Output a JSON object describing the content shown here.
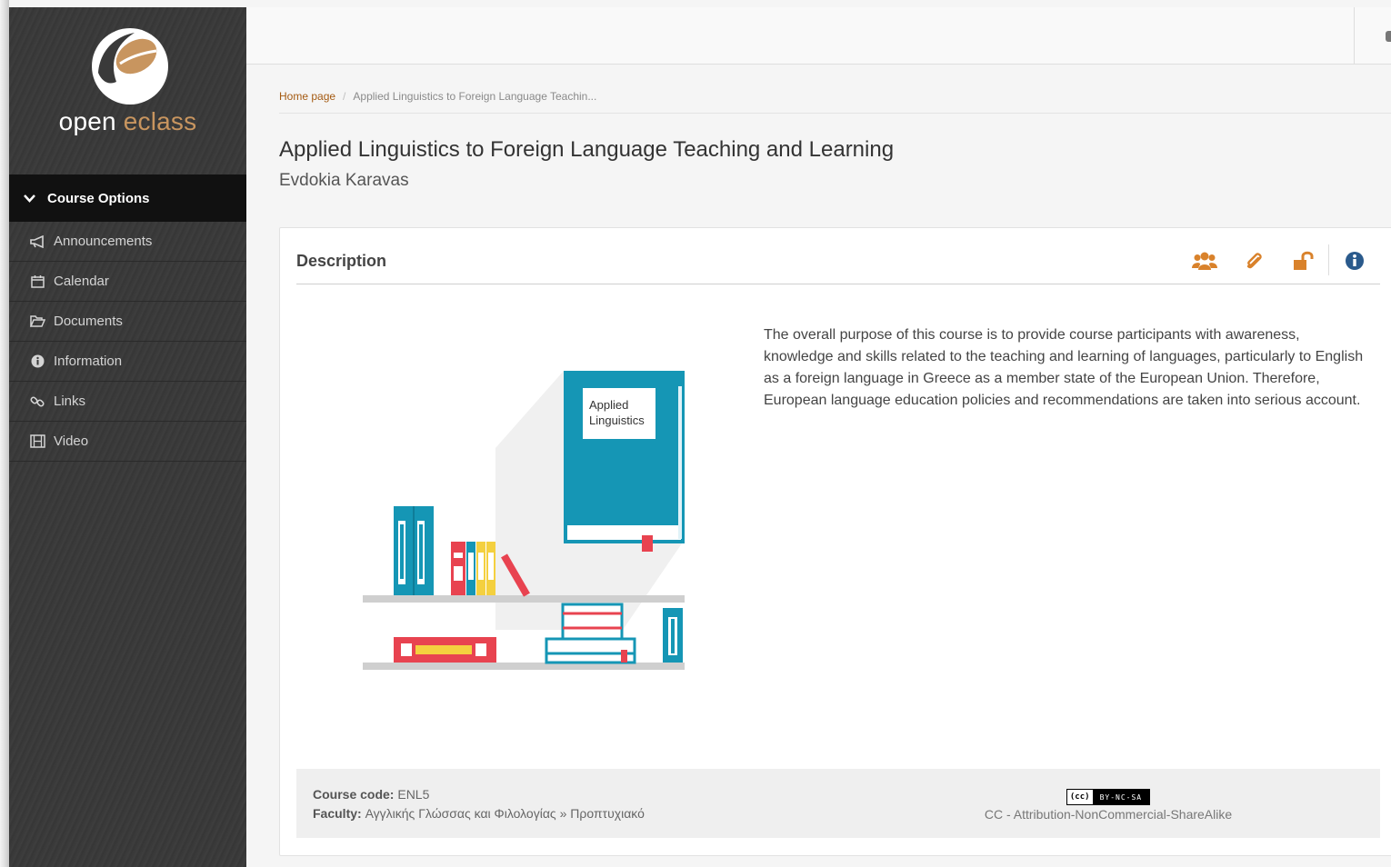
{
  "brand": {
    "name_part1": "open ",
    "name_part2": "eclass"
  },
  "sidebar": {
    "header": "Course Options",
    "items": [
      {
        "label": "Announcements",
        "icon": "bullhorn-icon"
      },
      {
        "label": "Calendar",
        "icon": "calendar-icon"
      },
      {
        "label": "Documents",
        "icon": "folder-open-icon"
      },
      {
        "label": "Information",
        "icon": "info-circle-icon"
      },
      {
        "label": "Links",
        "icon": "link-icon"
      },
      {
        "label": "Video",
        "icon": "film-icon"
      }
    ]
  },
  "breadcrumb": {
    "home": "Home page",
    "separator": "/",
    "current": "Applied Linguistics to Foreign Language Teachin..."
  },
  "course": {
    "title": "Applied Linguistics to Foreign Language Teaching and Learning",
    "professor": "Evdokia Karavas"
  },
  "panel": {
    "title": "Description",
    "tools": [
      {
        "icon": "users-icon"
      },
      {
        "icon": "paperclip-icon"
      },
      {
        "icon": "unlock-icon"
      },
      {
        "icon": "info-circle-icon"
      }
    ],
    "book_label_line1": "Applied",
    "book_label_line2": "Linguistics",
    "description": "The overall purpose of this course is to provide course participants with awareness, knowledge and skills related to the teaching and learning of languages, particularly to English as a foreign language in Greece as a member state of the European Union. Therefore, European language education policies and recommendations are taken into serious account.",
    "footer": {
      "course_code_label": "Course code:",
      "course_code": "ENL5",
      "faculty_label": "Faculty:",
      "faculty": "Αγγλικής Γλώσσας και Φιλολογίας » Προπτυχιακό",
      "license_badge_cc": "(cc)",
      "license_badge_terms": "BY-NC-SA",
      "license": "CC - Attribution-NonCommercial-ShareAlike"
    }
  },
  "colors": {
    "accent": "#c8955f",
    "link": "#a45a12",
    "icon_orange": "#d9822b",
    "info_blue": "#2a5a8c",
    "book_teal": "#1596b5"
  }
}
